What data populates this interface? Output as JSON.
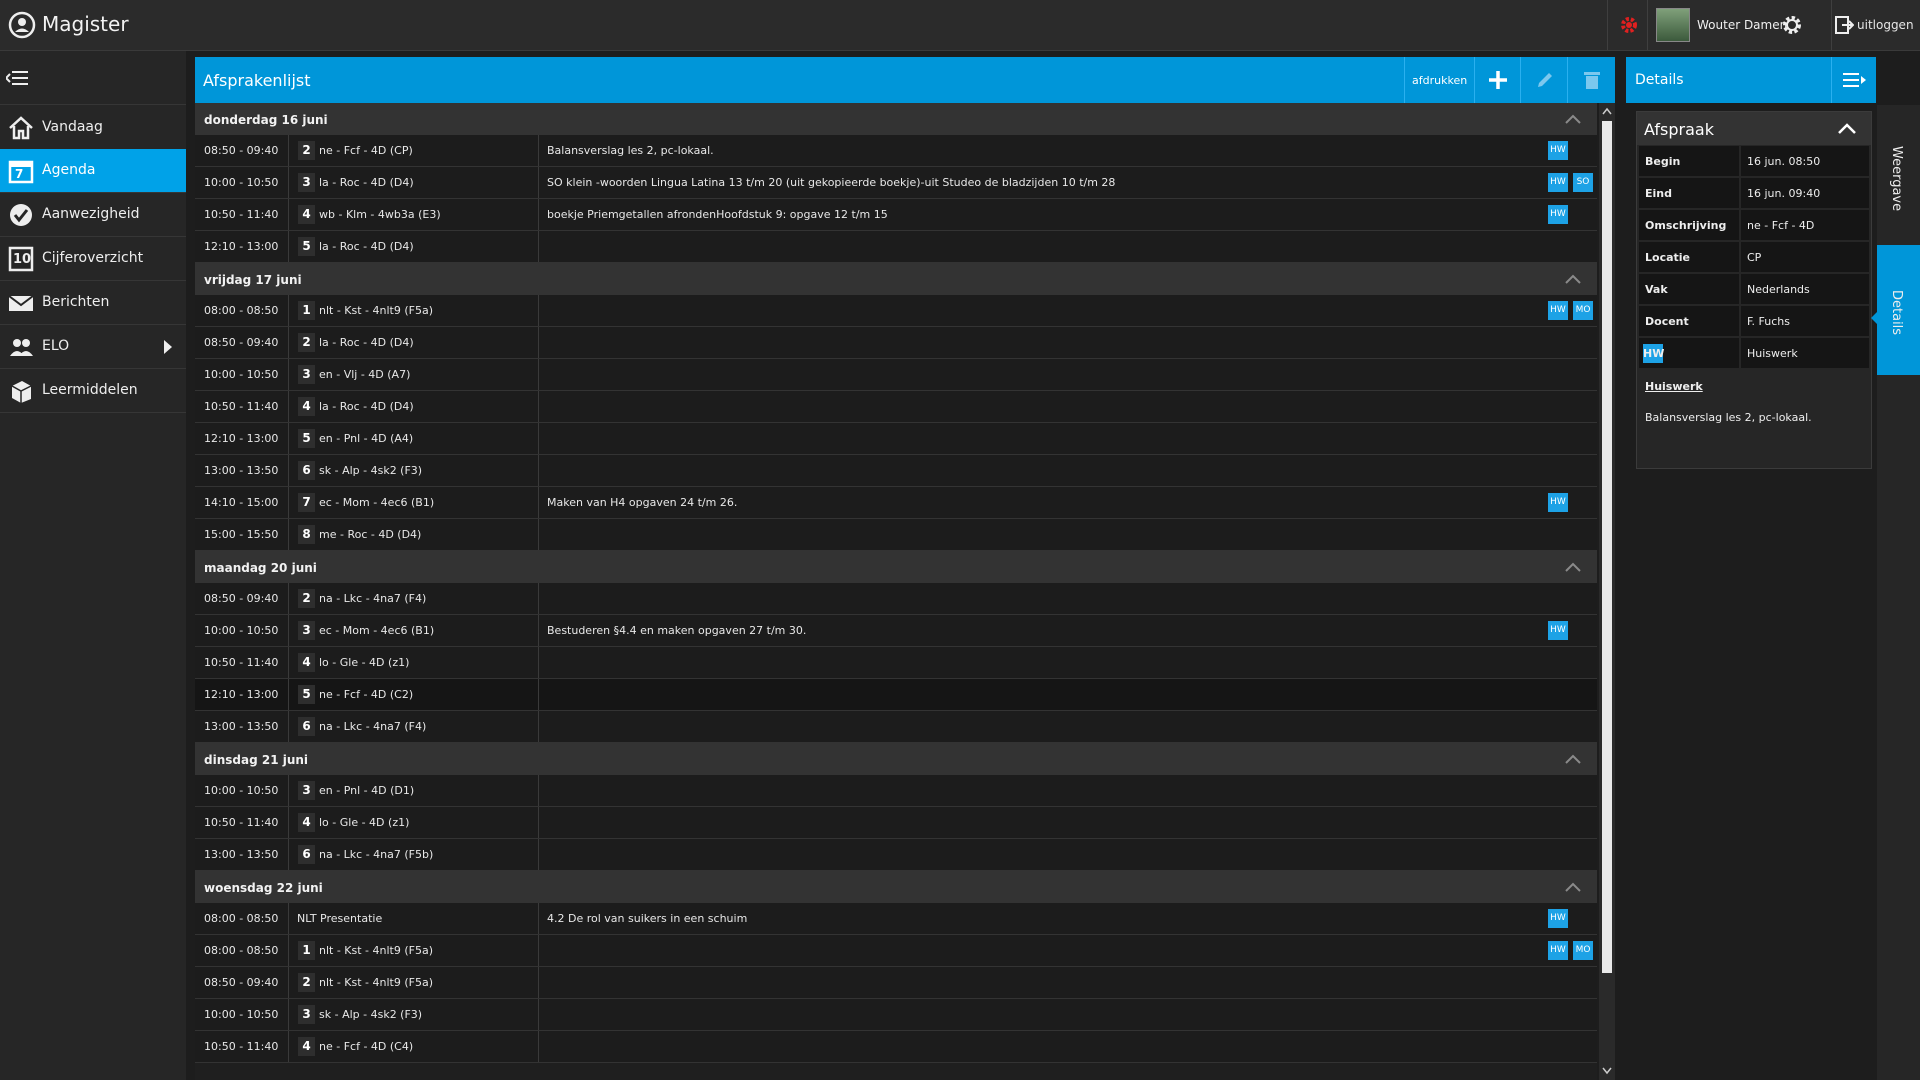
{
  "app": {
    "title": "Magister"
  },
  "user": {
    "name": "Wouter Damen",
    "logout": "uitloggen"
  },
  "sidebar": {
    "items": [
      {
        "label": "Vandaag",
        "icon": "home-icon"
      },
      {
        "label": "Agenda",
        "icon": "calendar-icon",
        "badge": "7",
        "active": true
      },
      {
        "label": "Aanwezigheid",
        "icon": "check-icon"
      },
      {
        "label": "Cijferoverzicht",
        "icon": "grades-icon",
        "badge": "10"
      },
      {
        "label": "Berichten",
        "icon": "envelope-icon"
      },
      {
        "label": "ELO",
        "icon": "people-icon"
      },
      {
        "label": "Leermiddelen",
        "icon": "books-icon"
      }
    ]
  },
  "main": {
    "title": "Afsprakenlijst",
    "print_label": "afdrukken",
    "days": [
      {
        "label": "donderdag 16 juni",
        "rows": [
          {
            "time": "08:50 - 09:40",
            "hour": "2",
            "subject": "ne - Fcf - 4D (CP)",
            "desc": "Balansverslag les 2, pc-lokaal.",
            "badges": [
              "HW"
            ]
          },
          {
            "time": "10:00 - 10:50",
            "hour": "3",
            "subject": "la - Roc - 4D (D4)",
            "desc": "SO klein -woorden Lingua Latina 13 t/m 20 (uit gekopieerde boekje)-uit Studeo de bladzijden 10 t/m 28",
            "badges": [
              "HW",
              "SO"
            ]
          },
          {
            "time": "10:50 - 11:40",
            "hour": "4",
            "subject": "wb - Klm - 4wb3a (E3)",
            "desc": "boekje Priemgetallen afrondenHoofdstuk 9: opgave 12 t/m 15",
            "badges": [
              "HW"
            ]
          },
          {
            "time": "12:10 - 13:00",
            "hour": "5",
            "subject": "la - Roc - 4D (D4)",
            "desc": "",
            "badges": []
          }
        ]
      },
      {
        "label": "vrijdag 17 juni",
        "rows": [
          {
            "time": "08:00 - 08:50",
            "hour": "1",
            "subject": "nlt - Kst - 4nlt9 (F5a)",
            "desc": "",
            "badges": [
              "HW",
              "MO"
            ]
          },
          {
            "time": "08:50 - 09:40",
            "hour": "2",
            "subject": "la - Roc - 4D (D4)",
            "desc": "",
            "badges": []
          },
          {
            "time": "10:00 - 10:50",
            "hour": "3",
            "subject": "en - Vlj - 4D (A7)",
            "desc": "",
            "badges": []
          },
          {
            "time": "10:50 - 11:40",
            "hour": "4",
            "subject": "la - Roc - 4D (D4)",
            "desc": "",
            "badges": []
          },
          {
            "time": "12:10 - 13:00",
            "hour": "5",
            "subject": "en - Pnl - 4D (A4)",
            "desc": "",
            "badges": []
          },
          {
            "time": "13:00 - 13:50",
            "hour": "6",
            "subject": "sk - Alp - 4sk2 (F3)",
            "desc": "",
            "badges": []
          },
          {
            "time": "14:10 - 15:00",
            "hour": "7",
            "subject": "ec - Mom - 4ec6 (B1)",
            "desc": "Maken van H4 opgaven 24 t/m 26.",
            "badges": [
              "HW"
            ]
          },
          {
            "time": "15:00 - 15:50",
            "hour": "8",
            "subject": "me - Roc - 4D (D4)",
            "desc": "",
            "badges": []
          }
        ]
      },
      {
        "label": "maandag 20 juni",
        "rows": [
          {
            "time": "08:50 - 09:40",
            "hour": "2",
            "subject": "na - Lkc - 4na7 (F4)",
            "desc": "",
            "badges": []
          },
          {
            "time": "10:00 - 10:50",
            "hour": "3",
            "subject": "ec - Mom - 4ec6 (B1)",
            "desc": "Bestuderen §4.4 en maken opgaven 27 t/m 30.",
            "badges": [
              "HW"
            ]
          },
          {
            "time": "10:50 - 11:40",
            "hour": "4",
            "subject": "lo - Gle - 4D (z1)",
            "desc": "",
            "badges": []
          },
          {
            "time": "12:10 - 13:00",
            "hour": "5",
            "subject": "ne - Fcf - 4D (C2)",
            "desc": "",
            "badges": []
          },
          {
            "time": "13:00 - 13:50",
            "hour": "6",
            "subject": "na - Lkc - 4na7 (F4)",
            "desc": "",
            "badges": []
          }
        ]
      },
      {
        "label": "dinsdag 21 juni",
        "rows": [
          {
            "time": "10:00 - 10:50",
            "hour": "3",
            "subject": "en - Pnl - 4D (D1)",
            "desc": "",
            "badges": []
          },
          {
            "time": "10:50 - 11:40",
            "hour": "4",
            "subject": "lo - Gle - 4D (z1)",
            "desc": "",
            "badges": []
          },
          {
            "time": "13:00 - 13:50",
            "hour": "6",
            "subject": "na - Lkc - 4na7 (F5b)",
            "desc": "",
            "badges": []
          }
        ]
      },
      {
        "label": "woensdag 22 juni",
        "rows": [
          {
            "time": "08:00 - 08:50",
            "hour": "",
            "subject": "NLT Presentatie",
            "desc": "4.2 De rol van suikers in een schuim",
            "badges": [
              "HW"
            ]
          },
          {
            "time": "08:00 - 08:50",
            "hour": "1",
            "subject": "nlt - Kst - 4nlt9 (F5a)",
            "desc": "",
            "badges": [
              "HW",
              "MO"
            ]
          },
          {
            "time": "08:50 - 09:40",
            "hour": "2",
            "subject": "nlt - Kst - 4nlt9 (F5a)",
            "desc": "",
            "badges": []
          },
          {
            "time": "10:00 - 10:50",
            "hour": "3",
            "subject": "sk - Alp - 4sk2 (F3)",
            "desc": "",
            "badges": []
          },
          {
            "time": "10:50 - 11:40",
            "hour": "4",
            "subject": "ne - Fcf - 4D (C4)",
            "desc": "",
            "badges": []
          }
        ]
      }
    ]
  },
  "details": {
    "title": "Details",
    "section": "Afspraak",
    "fields": [
      {
        "key": "Begin",
        "value": "16 jun. 08:50"
      },
      {
        "key": "Eind",
        "value": "16 jun. 09:40"
      },
      {
        "key": "Omschrijving",
        "value": "ne - Fcf - 4D"
      },
      {
        "key": "Locatie",
        "value": "CP"
      },
      {
        "key": "Vak",
        "value": "Nederlands"
      },
      {
        "key": "Docent",
        "value": "F. Fuchs"
      },
      {
        "key": "HW",
        "value": "Huiswerk"
      }
    ],
    "homework_link": "Huiswerk",
    "homework_text": "Balansverslag les 2, pc-lokaal."
  },
  "rail": {
    "weergave": "Weergave",
    "details": "Details"
  },
  "colors": {
    "accent": "#0096d9",
    "badge": "#1da2e6",
    "alert": "#e02020"
  }
}
